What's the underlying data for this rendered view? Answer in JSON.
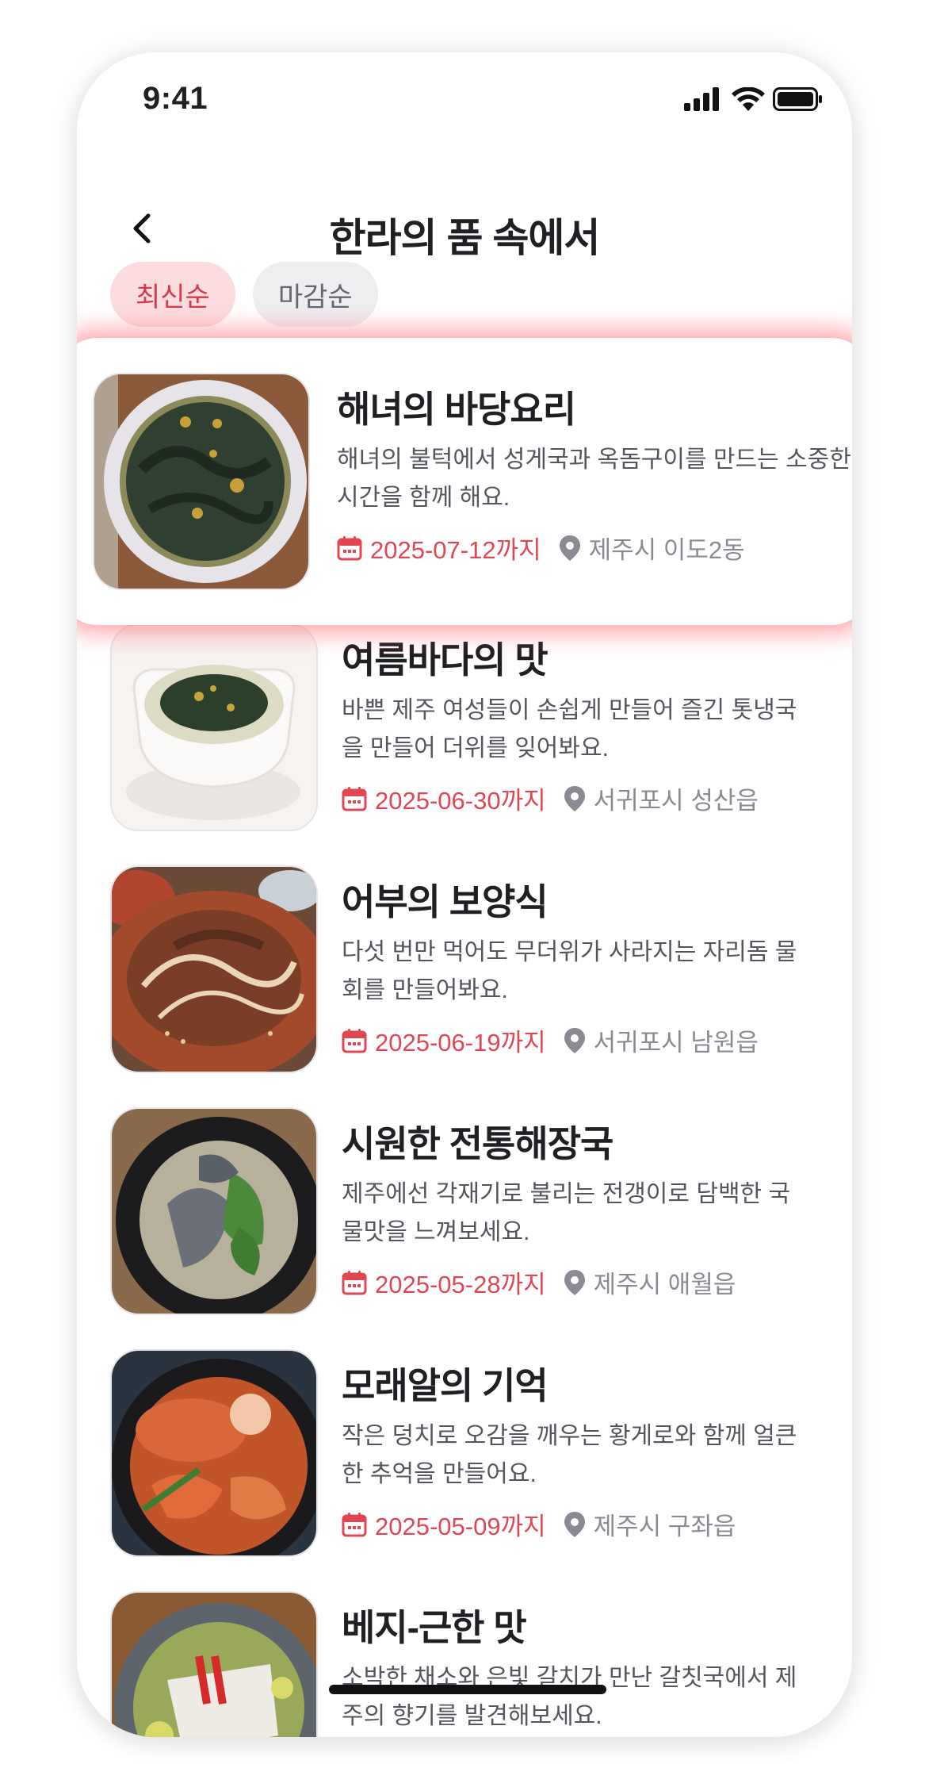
{
  "status_bar": {
    "time": "9:41"
  },
  "header": {
    "title": "한라의 품 속에서"
  },
  "filters": [
    {
      "label": "최신순",
      "active": true
    },
    {
      "label": "마감순",
      "active": false
    }
  ],
  "items": [
    {
      "name": "해녀의 바당요리",
      "description": "해녀의 불턱에서 성게국과 옥돔구이를 만드는 소중한 시간을 함께 해요.",
      "deadline": "2025-07-12까지",
      "location": "제주시 이도2동",
      "image": "seaweed-soup-bowl"
    },
    {
      "name": "여름바다의 맛",
      "description": "바쁜 제주 여성들이 손쉽게 만들어 즐긴 톳냉국을 만들어 더위를 잊어봐요.",
      "deadline": "2025-06-30까지",
      "location": "서귀포시 성산읍",
      "image": "cold-seaweed-soup"
    },
    {
      "name": "어부의 보양식",
      "description": "다섯 번만 먹어도 무더위가 사라지는 자리돔 물회를 만들어봐요.",
      "deadline": "2025-06-19까지",
      "location": "서귀포시 남원읍",
      "image": "spicy-fish-salad"
    },
    {
      "name": "시원한 전통해장국",
      "description": "제주에선 각재기로 불리는 전갱이로 담백한 국물맛을 느껴보세요.",
      "deadline": "2025-05-28까지",
      "location": "제주시 애월읍",
      "image": "fish-soup-pot"
    },
    {
      "name": "모래알의 기억",
      "description": "작은 덩치로 오감을 깨우는 황게로와 함께 얼큰한 추억을 만들어요.",
      "deadline": "2025-05-09까지",
      "location": "제주시 구좌읍",
      "image": "crab-stew"
    },
    {
      "name": "베지-근한 맛",
      "description": "소박한 채소와 은빛 갈치가 만난 갈칫국에서 제주의 향기를 발견해보세요.",
      "deadline": "",
      "location": "",
      "image": "hairtail-soup"
    }
  ],
  "colors": {
    "accent": "#e04752",
    "chip_active_bg": "#fbdde0",
    "chip_inactive_bg": "#eeeef1",
    "location_gray": "#8a8a94"
  },
  "icons": [
    "back-chevron-icon",
    "calendar-icon",
    "location-pin-icon",
    "signal-icon",
    "wifi-icon",
    "battery-icon"
  ]
}
